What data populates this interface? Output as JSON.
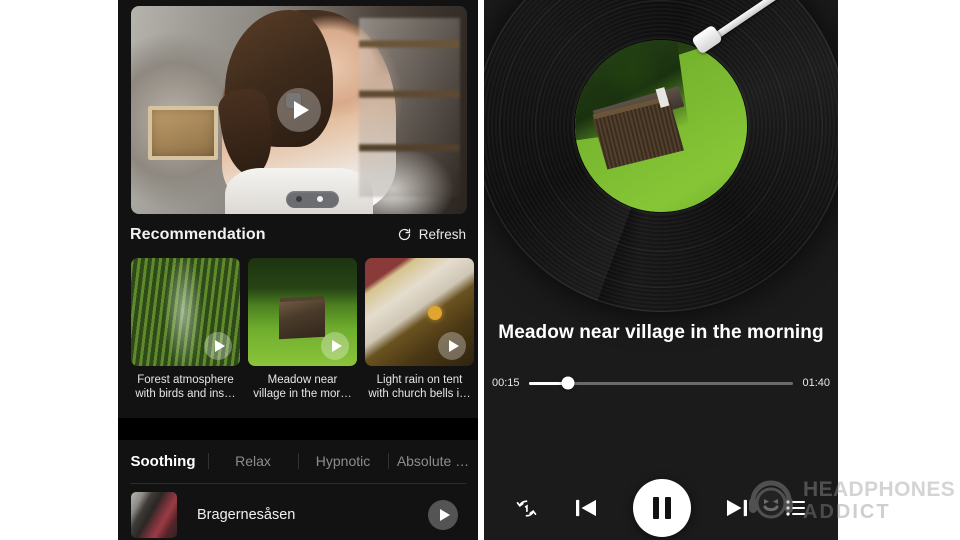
{
  "app": {
    "theme_background": "#121212",
    "panel_right_background": "#1b1b1b",
    "accent": "#ffffff"
  },
  "left_panel": {
    "hero": {
      "name": "featured-video",
      "play_icon": "play-icon"
    },
    "section": {
      "title": "Recommendation",
      "refresh_label": "Refresh",
      "refresh_icon": "refresh-icon"
    },
    "recommendations": [
      {
        "label": "Forest atmosphere\nwith birds and ins…",
        "thumb": "forest-waterfall",
        "play_icon": "play-icon"
      },
      {
        "label": "Meadow near\nvillage in the mor…",
        "thumb": "meadow-barn",
        "play_icon": "play-icon"
      },
      {
        "label": "Light rain on tent\nwith church bells i…",
        "thumb": "church-clock",
        "play_icon": "play-icon"
      }
    ],
    "tabs": [
      {
        "label": "Soothing",
        "active": true
      },
      {
        "label": "Relax",
        "active": false
      },
      {
        "label": "Hypnotic",
        "active": false
      },
      {
        "label": "Absolute …",
        "active": false
      }
    ],
    "track_list": [
      {
        "name": "Bragernesåsen",
        "play_icon": "play-icon"
      }
    ]
  },
  "right_panel": {
    "now_playing": {
      "title": "Meadow near village in the morning",
      "artwork": "meadow-barn",
      "turntable_icon": "vinyl-record",
      "tonearm_icon": "tonearm"
    },
    "seek": {
      "elapsed": "00:15",
      "duration": "01:40",
      "progress_percent": 15
    },
    "controls": [
      {
        "name": "repeat-one-button",
        "icon": "repeat-one-icon"
      },
      {
        "name": "previous-button",
        "icon": "skip-previous-icon"
      },
      {
        "name": "play-pause-button",
        "icon": "pause-icon"
      },
      {
        "name": "next-button",
        "icon": "skip-next-icon"
      },
      {
        "name": "playlist-button",
        "icon": "playlist-icon"
      }
    ]
  },
  "watermark": {
    "line1": "HEADPHONES",
    "line2": "ADDICT",
    "logo_icon": "headphones-smiley-logo"
  }
}
